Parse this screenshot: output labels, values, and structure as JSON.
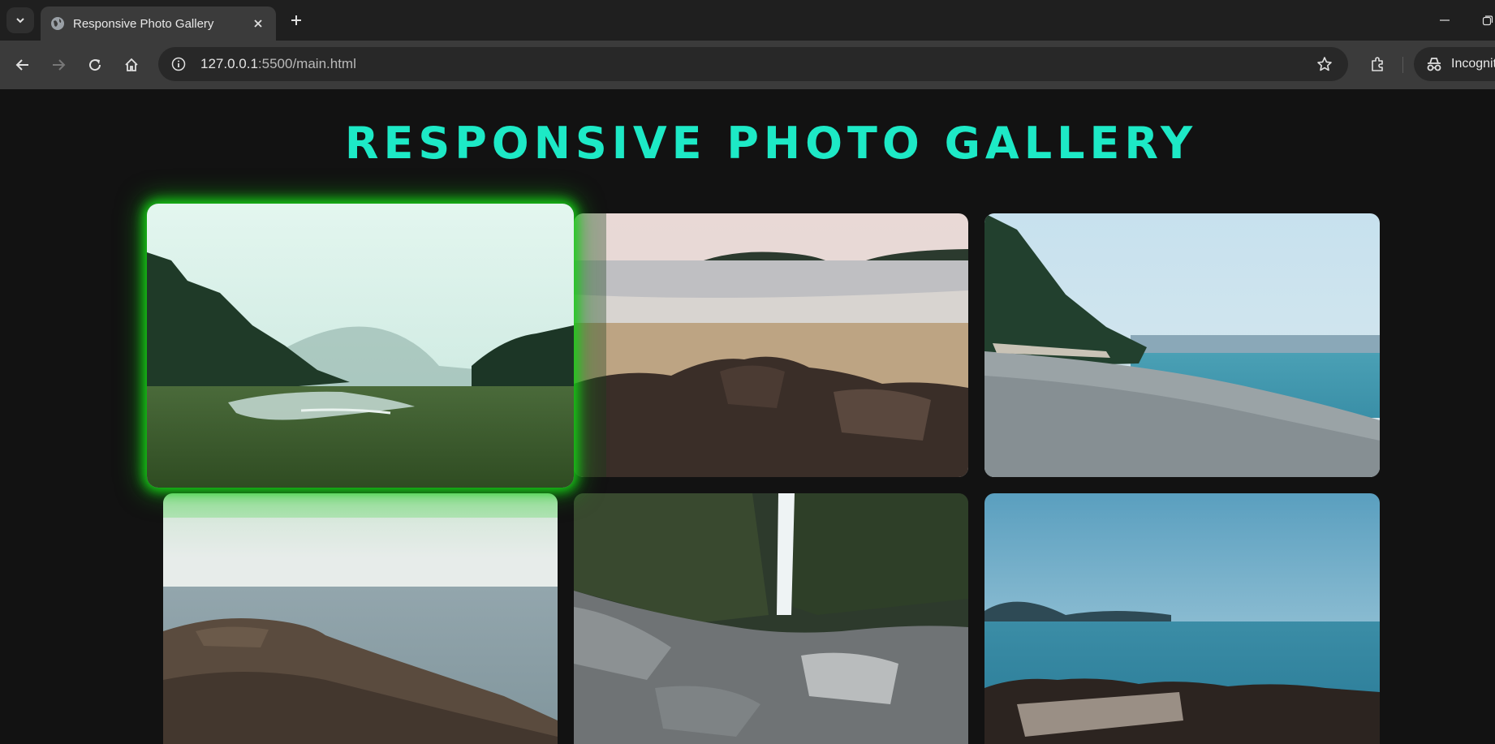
{
  "browser": {
    "tab_title": "Responsive Photo Gallery",
    "url_host": "127.0.0.1",
    "url_path": ":5500/main.html",
    "profile_label": "Incognito"
  },
  "page": {
    "title": "RESPONSIVE PHOTO GALLERY"
  },
  "gallery": {
    "photos": [
      {
        "subject": "misty forest valley with river",
        "highlighted": true
      },
      {
        "subject": "beach with dark rocks and islands",
        "highlighted": false
      },
      {
        "subject": "pebble beach with evergreen trees and sea",
        "highlighted": false
      },
      {
        "subject": "rocky shoreline under hazy sky",
        "highlighted": false
      },
      {
        "subject": "waterfall in rocky canyon",
        "highlighted": false
      },
      {
        "subject": "blue sea with distant islands and rocks",
        "highlighted": false
      }
    ]
  },
  "colors": {
    "title": "#1de9c6",
    "glow": "#17d117",
    "page_bg": "#121212"
  },
  "icons": [
    "tab-search-icon",
    "globe-icon",
    "close-icon",
    "plus-icon",
    "minimize-icon",
    "restore-icon",
    "back-icon",
    "forward-icon",
    "reload-icon",
    "home-icon",
    "site-info-icon",
    "star-icon",
    "extensions-icon",
    "incognito-icon"
  ]
}
